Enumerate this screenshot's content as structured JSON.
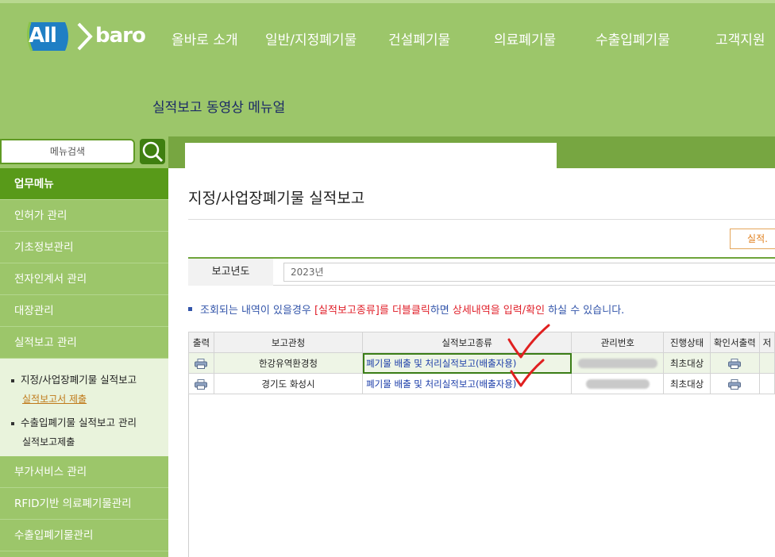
{
  "header": {
    "logo_left": "All",
    "logo_right": "baro",
    "nav": [
      "올바로 소개",
      "일반/지정폐기물",
      "건설폐기물",
      "의료폐기물",
      "수출입폐기물",
      "고객지원"
    ],
    "subtitle": "실적보고 동영상 메뉴얼"
  },
  "sidebar": {
    "search_placeholder": "메뉴검색",
    "menu": [
      "업무메뉴",
      "인허가 관리",
      "기초정보관리",
      "전자인계서 관리",
      "대장관리",
      "실적보고 관리"
    ],
    "submenu": {
      "group1": "지정/사업장폐기물 실적보고",
      "group1_link": "실적보고서 제출",
      "group2": "수출입폐기물 실적보고 관리",
      "group2_link": "실적보고제출"
    },
    "menu_bottom": [
      "부가서비스 관리",
      "RFID기반 의료폐기물관리",
      "수출입폐기물관리"
    ]
  },
  "main": {
    "title": "지정/사업장폐기물 실적보고",
    "top_button": "실적.",
    "filter": {
      "label": "보고년도",
      "value": "2023년"
    },
    "notice": {
      "p1": "조회되는 내역이 있을경우 ",
      "p2": "[실적보고종류]",
      "p3": "를 더블클릭",
      "p4": "하면 ",
      "p5": "상세내역을 입력/확인",
      "p6": " 하실 수 있습니다."
    },
    "table": {
      "columns": [
        "출력",
        "보고관청",
        "실적보고종류",
        "관리번호",
        "진행상태",
        "확인서출력",
        "저"
      ],
      "rows": [
        {
          "agency": "한강유역환경청",
          "type": "폐기물 배출 및 처리실적보고(배출자용)",
          "status": "최초대상"
        },
        {
          "agency": "경기도 화성시",
          "type": "폐기물 배출 및 처리실적보고(배출자용)",
          "status": "최초대상"
        }
      ]
    }
  },
  "colors": {
    "header_green": "#9cc66a",
    "active_menu": "#589a19",
    "link_blue": "#1a3ca8",
    "notice_red": "#e0202a",
    "check_red": "#e02020"
  }
}
